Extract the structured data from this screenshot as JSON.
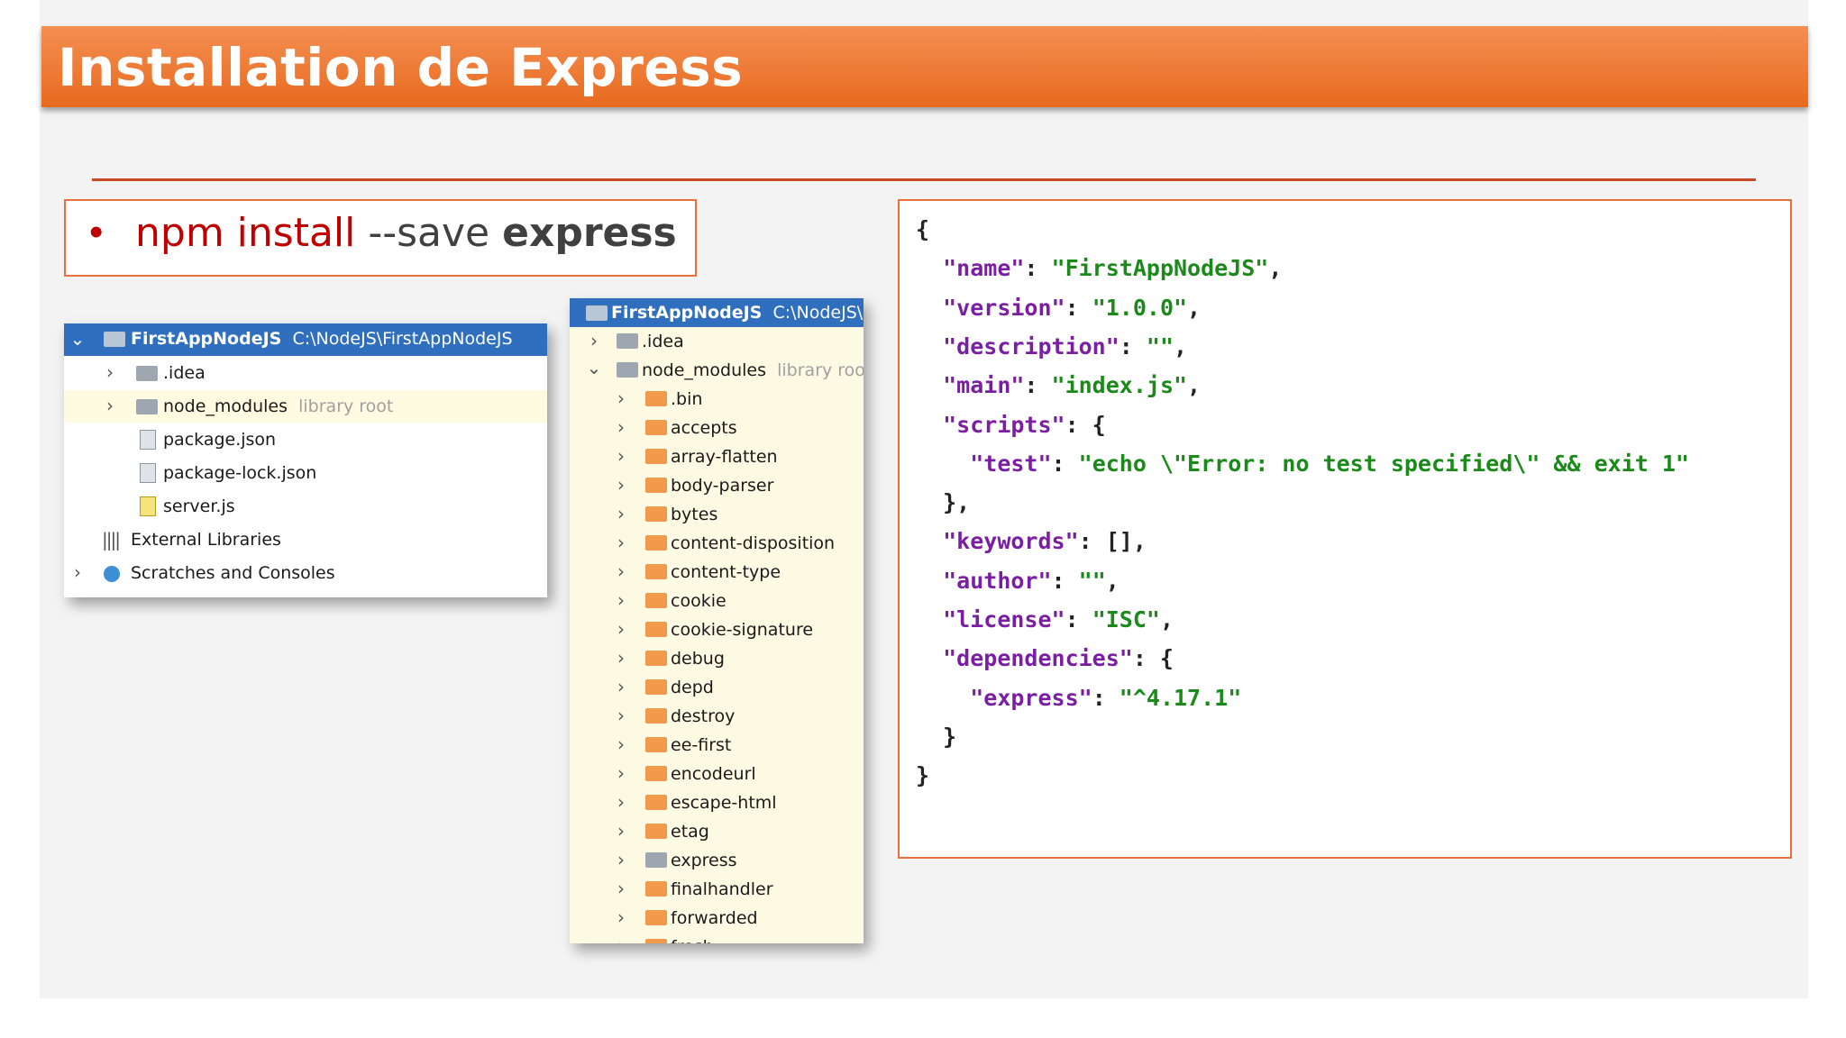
{
  "slide": {
    "title": "Installation de Express"
  },
  "command": {
    "bullet": "•",
    "part1": "npm install",
    "part2": " --save ",
    "part3": "express"
  },
  "project_tree": {
    "root_name": "FirstAppNodeJS",
    "root_path": "C:\\NodeJS\\FirstAppNodeJS",
    "items": [
      {
        "label": "idea_dir",
        "text": ".idea"
      },
      {
        "label": "node_modules",
        "text": "node_modules",
        "suffix": "library root"
      },
      {
        "label": "package",
        "text": "package.json"
      },
      {
        "label": "package_lock",
        "text": "package-lock.json"
      },
      {
        "label": "server",
        "text": "server.js"
      },
      {
        "label": "ext_libs",
        "text": "External Libraries"
      },
      {
        "label": "scratches",
        "text": "Scratches and Consoles"
      }
    ]
  },
  "modules_tree": {
    "root_name": "FirstAppNodeJS",
    "root_path": "C:\\NodeJS\\First",
    "idea": ".idea",
    "node_modules": "node_modules",
    "node_modules_suffix": "library root",
    "folders": [
      ".bin",
      "accepts",
      "array-flatten",
      "body-parser",
      "bytes",
      "content-disposition",
      "content-type",
      "cookie",
      "cookie-signature",
      "debug",
      "depd",
      "destroy",
      "ee-first",
      "encodeurl",
      "escape-html",
      "etag",
      "express",
      "finalhandler",
      "forwarded",
      "fresh"
    ]
  },
  "package_json": {
    "lines": [
      "{",
      "  \"name\": \"FirstAppNodeJS\",",
      "  \"version\": \"1.0.0\",",
      "  \"description\": \"\",",
      "  \"main\": \"index.js\",",
      "  \"scripts\": {",
      "    \"test\": \"echo \\\"Error: no test specified\\\" && exit 1\"",
      "  },",
      "  \"keywords\": [],",
      "  \"author\": \"\",",
      "  \"license\": \"ISC\",",
      "  \"dependencies\": {",
      "    \"express\": \"^4.17.1\"",
      "  }",
      "}"
    ]
  },
  "colors": {
    "title_bar": "#e86a1f",
    "accent_red": "#c00000",
    "selection_blue": "#2f6fbd",
    "json_key": "#7b1fa2",
    "json_value": "#1b8a1b"
  }
}
